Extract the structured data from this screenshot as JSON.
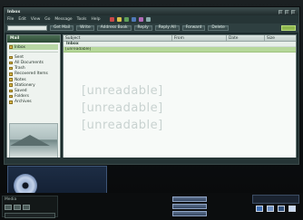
{
  "window": {
    "title": "Inbox",
    "menu": [
      "File",
      "Edit",
      "View",
      "Go",
      "Message",
      "Tools",
      "Help"
    ]
  },
  "toolbar": {
    "search_value": "",
    "buttons": [
      "Get Mail",
      "Write",
      "Address Book",
      "Reply",
      "Reply All",
      "Forward",
      "Delete"
    ]
  },
  "sidebar": {
    "header": "Mail",
    "items": [
      {
        "label": "Inbox",
        "selected": true
      },
      {
        "label": "Sent",
        "selected": false
      },
      {
        "label": "All Documents",
        "selected": false
      },
      {
        "label": "Trash",
        "selected": false
      },
      {
        "label": "Recovered Items",
        "selected": false
      },
      {
        "label": "Notes",
        "selected": false
      },
      {
        "label": "Stationery",
        "selected": false
      },
      {
        "label": "Saved",
        "selected": false
      },
      {
        "label": "Folders",
        "selected": false
      },
      {
        "label": "Archives",
        "selected": false
      }
    ]
  },
  "list": {
    "columns": [
      "Subject",
      "From",
      "Date",
      "Size"
    ],
    "group_label": "Inbox",
    "rows": [
      {
        "subject": "[unreadable]",
        "from": "",
        "date": "",
        "size": ""
      }
    ]
  },
  "overlay_text": {
    "lines": [
      "[unreadable]",
      "[unreadable]",
      "[unreadable]"
    ]
  },
  "player": {
    "line1": "",
    "line2": ""
  },
  "dock": {
    "label": "Media",
    "select_value": ""
  },
  "taskbar": {
    "items": [
      "",
      "",
      ""
    ]
  },
  "colors": {
    "accent": "#8fb74f",
    "selection": "#b6d89a",
    "window_bg": "#1b2a2b"
  }
}
